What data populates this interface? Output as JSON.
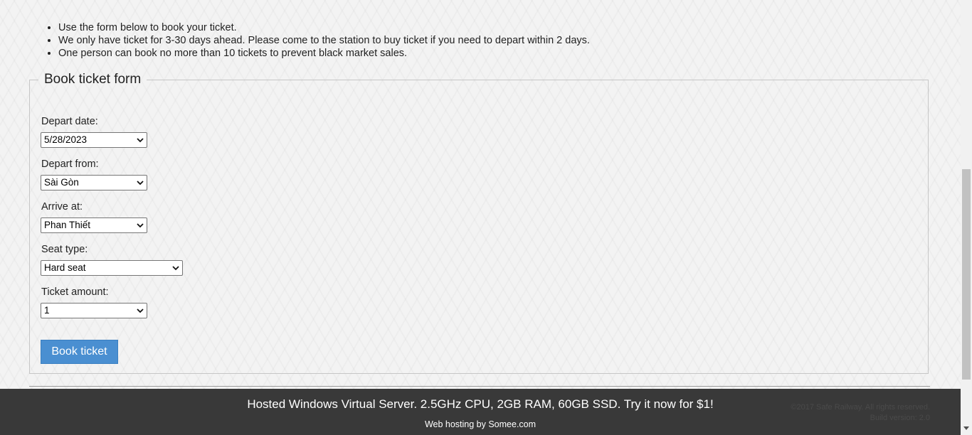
{
  "notes": [
    "Use the form below to book your ticket.",
    "We only have ticket for 3-30 days ahead. Please come to the station to buy ticket if you need to depart within 2 days.",
    "One person can book no more than 10 tickets to prevent black market sales."
  ],
  "form": {
    "legend": "Book ticket form",
    "depart_date": {
      "label": "Depart date:",
      "value": "5/28/2023"
    },
    "depart_from": {
      "label": "Depart from:",
      "value": "Sài Gòn"
    },
    "arrive_at": {
      "label": "Arrive at:",
      "value": "Phan Thiết"
    },
    "seat_type": {
      "label": "Seat type:",
      "value": "Hard seat"
    },
    "ticket_amount": {
      "label": "Ticket amount:",
      "value": "1"
    },
    "submit_label": "Book ticket"
  },
  "footer": {
    "ad": "Hosted Windows Virtual Server. 2.5GHz CPU, 2GB RAM, 60GB SSD. Try it now for $1!",
    "hosting": "Web hosting by Somee.com",
    "copyright": "©2017 Safe Railway. All rights reserved.",
    "build": "Build version: 2.0"
  },
  "colors": {
    "button": "#4a8fd1",
    "footer_bg": "#393939"
  }
}
